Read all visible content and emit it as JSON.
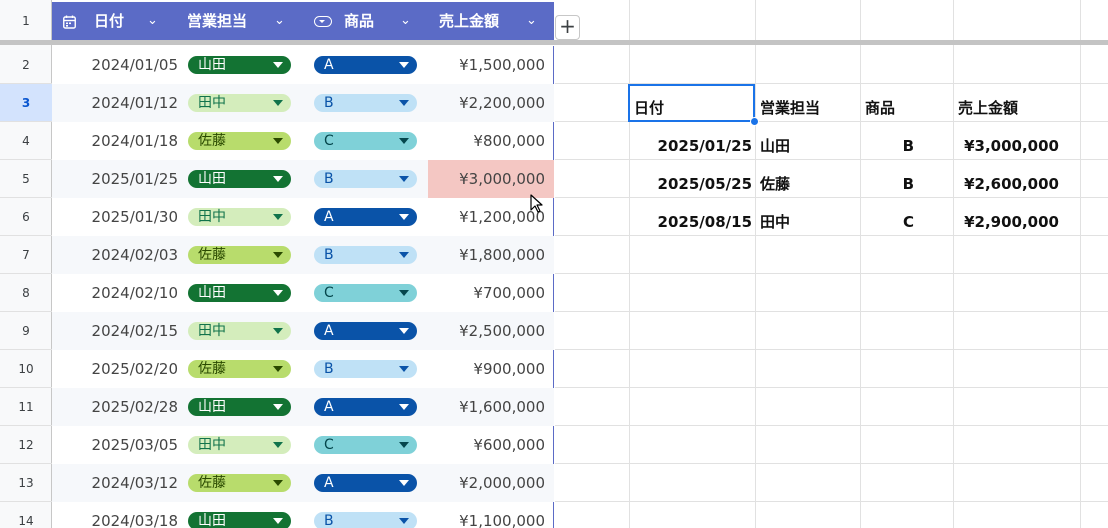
{
  "row_numbers": [
    "1",
    "2",
    "3",
    "4",
    "5",
    "6",
    "7",
    "8",
    "9",
    "10",
    "11",
    "12",
    "13",
    "14"
  ],
  "selected_row": "3",
  "table_header": {
    "date": "日付",
    "rep": "営業担当",
    "product": "商品",
    "amount": "売上金額",
    "date_icon": "calendar-icon",
    "product_icon": "dropdown-chip-icon",
    "header_color": "#5b6bc6"
  },
  "add_column_label": "+",
  "rows": [
    {
      "date": "2024/01/05",
      "rep": "山田",
      "product": "A",
      "amount": "¥1,500,000"
    },
    {
      "date": "2024/01/12",
      "rep": "田中",
      "product": "B",
      "amount": "¥2,200,000"
    },
    {
      "date": "2024/01/18",
      "rep": "佐藤",
      "product": "C",
      "amount": "¥800,000"
    },
    {
      "date": "2025/01/25",
      "rep": "山田",
      "product": "B",
      "amount": "¥3,000,000"
    },
    {
      "date": "2025/01/30",
      "rep": "田中",
      "product": "A",
      "amount": "¥1,200,000"
    },
    {
      "date": "2024/02/03",
      "rep": "佐藤",
      "product": "B",
      "amount": "¥1,800,000"
    },
    {
      "date": "2024/02/10",
      "rep": "山田",
      "product": "C",
      "amount": "¥700,000"
    },
    {
      "date": "2024/02/15",
      "rep": "田中",
      "product": "A",
      "amount": "¥2,500,000"
    },
    {
      "date": "2025/02/20",
      "rep": "佐藤",
      "product": "B",
      "amount": "¥900,000"
    },
    {
      "date": "2025/02/28",
      "rep": "山田",
      "product": "A",
      "amount": "¥1,600,000"
    },
    {
      "date": "2025/03/05",
      "rep": "田中",
      "product": "C",
      "amount": "¥600,000"
    },
    {
      "date": "2024/03/12",
      "rep": "佐藤",
      "product": "A",
      "amount": "¥2,000,000"
    },
    {
      "date": "2024/03/18",
      "rep": "山田",
      "product": "B",
      "amount": "¥1,100,000"
    }
  ],
  "highlighted_amount": "¥3,000,000",
  "chip_colors": {
    "山田": {
      "bg": "#137333",
      "fg": "#ffffff"
    },
    "田中": {
      "bg": "#d4edbc",
      "fg": "#11734b"
    },
    "佐藤": {
      "bg": "#b8dc6c",
      "fg": "#2a4a00"
    },
    "A": {
      "bg": "#0a53a8",
      "fg": "#ffffff"
    },
    "B": {
      "bg": "#bfe1f6",
      "fg": "#0a53a8"
    },
    "C": {
      "bg": "#7fd1d8",
      "fg": "#05474d"
    }
  },
  "filter_result": {
    "headers": {
      "date": "日付",
      "rep": "営業担当",
      "product": "商品",
      "amount": "売上金額"
    },
    "rows": [
      {
        "date": "2025/01/25",
        "rep": "山田",
        "product": "B",
        "amount": "¥3,000,000"
      },
      {
        "date": "2025/05/25",
        "rep": "佐藤",
        "product": "B",
        "amount": "¥2,600,000"
      },
      {
        "date": "2025/08/15",
        "rep": "田中",
        "product": "C",
        "amount": "¥2,900,000"
      }
    ]
  }
}
